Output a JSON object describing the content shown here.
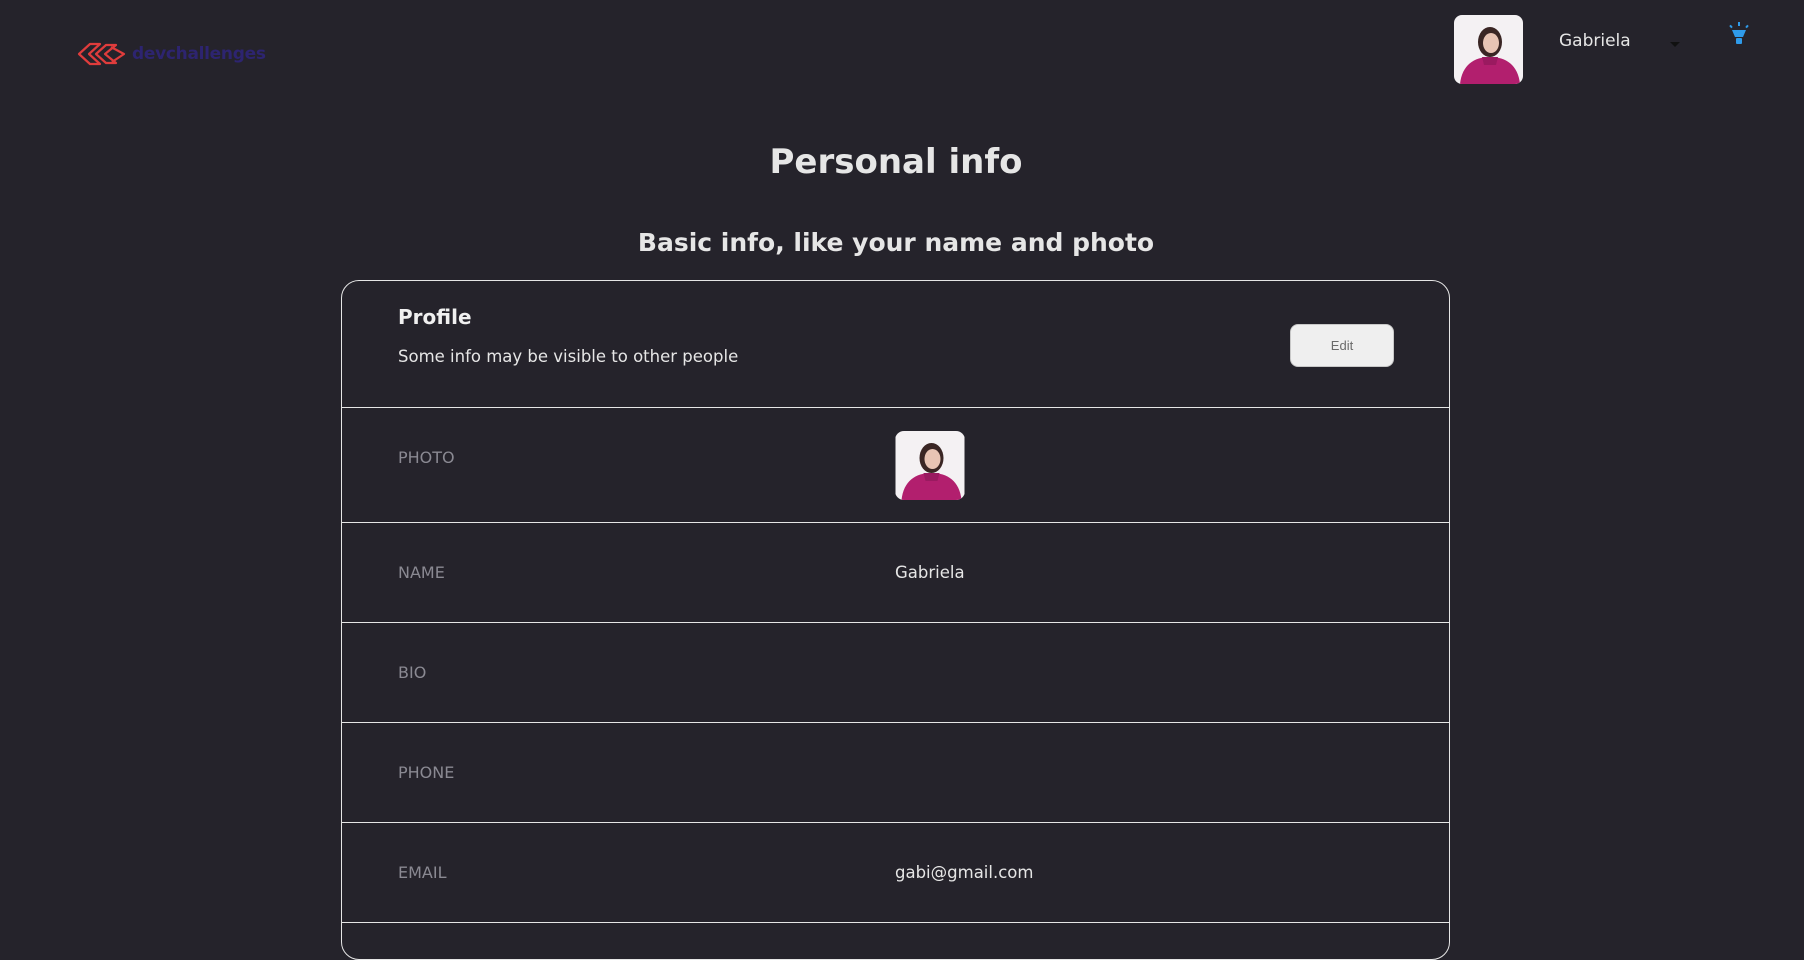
{
  "header": {
    "logo_text": "devchallenges",
    "user_name": "Gabriela"
  },
  "main": {
    "title": "Personal info",
    "subtitle": "Basic info, like your name and photo"
  },
  "profile": {
    "title": "Profile",
    "description": "Some info may be visible to other people",
    "edit_label": "Edit",
    "rows": {
      "photo": {
        "label": "PHOTO"
      },
      "name": {
        "label": "NAME",
        "value": "Gabriela"
      },
      "bio": {
        "label": "BIO",
        "value": ""
      },
      "phone": {
        "label": "PHONE",
        "value": ""
      },
      "email": {
        "label": "EMAIL",
        "value": "gabi@gmail.com"
      }
    }
  },
  "colors": {
    "background": "#25232b",
    "logo_accent": "#e03c3c",
    "theme_icon": "#2f9bea",
    "avatar_sweater": "#b21f6e"
  },
  "icons": {
    "logo": "devchallenges-logo-icon",
    "theme_toggle": "lightbulb-icon",
    "dropdown": "caret-down-icon"
  }
}
